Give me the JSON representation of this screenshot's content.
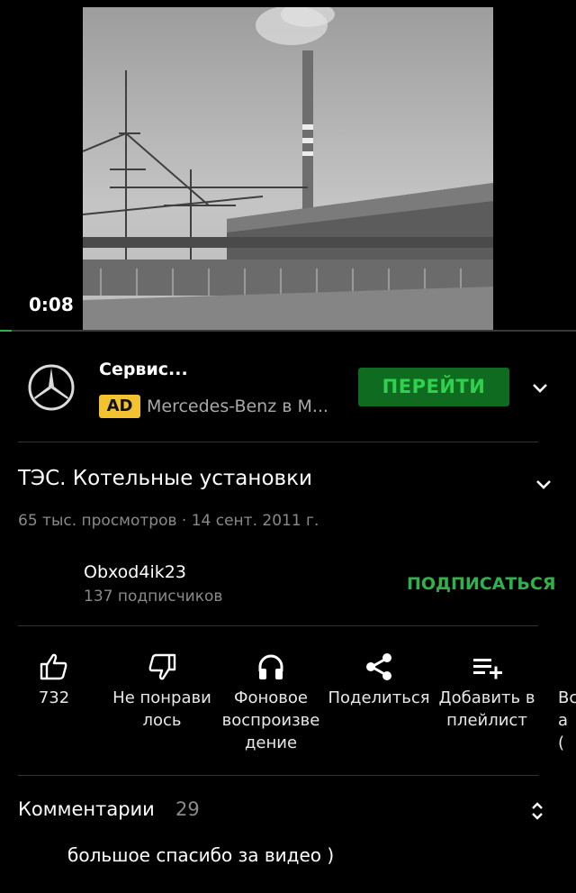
{
  "video": {
    "time": "0:08",
    "progress": 0.02,
    "accent": "#2fb24c"
  },
  "ad": {
    "title": "Сервис...",
    "badge": "AD",
    "sponsor": "Mercedes-Benz в М...",
    "button": "ПЕРЕЙТИ",
    "logo_icon": "mercedes-star-icon"
  },
  "video_info": {
    "title": "ТЭС. Котельные установки",
    "meta": "65 тыс. просмотров · 14 сент. 2011 г."
  },
  "channel": {
    "name": "Obxod4ik23",
    "subscribers": "137 подписчиков",
    "subscribe": "ПОДПИСАТЬСЯ"
  },
  "actions": [
    {
      "icon": "thumbs-up-icon",
      "label": "732"
    },
    {
      "icon": "thumbs-down-icon",
      "label": "Не понрави\nлось"
    },
    {
      "icon": "headphones-icon",
      "label": "Фоновое\nвоспроизве\nдение"
    },
    {
      "icon": "share-icon",
      "label": "Поделиться"
    },
    {
      "icon": "playlist-add-icon",
      "label": "Добавить в\nплейлист"
    },
    {
      "icon": "partial-action-icon",
      "label": "Вс\nа\n("
    }
  ],
  "comments": {
    "label": "Комментарии",
    "count": "29",
    "first": "большое спасибо за видео )"
  }
}
